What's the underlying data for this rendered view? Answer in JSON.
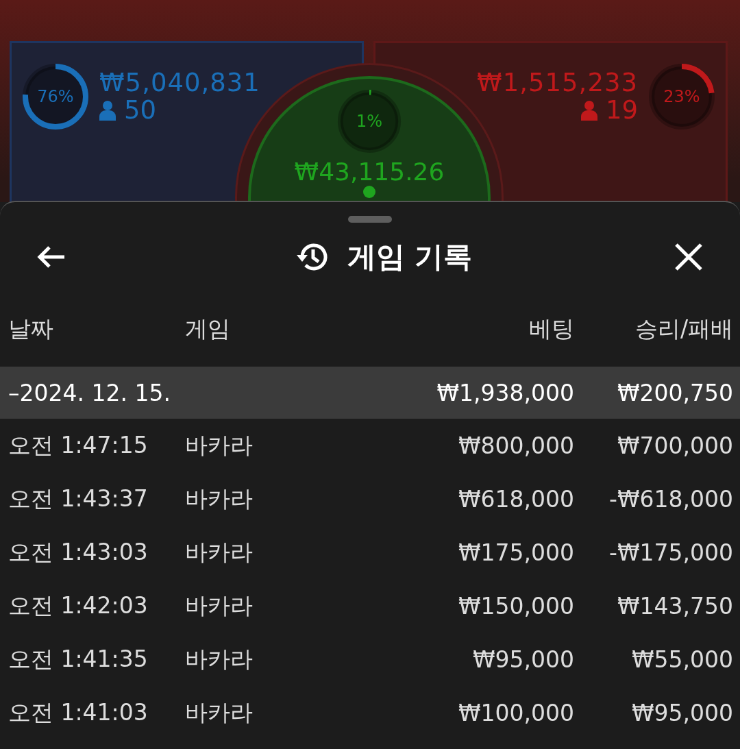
{
  "pools": [
    {
      "kind": "left",
      "level": 0.76,
      "percent": "76%",
      "amount": "₩5,040,831",
      "players": "50",
      "color": "#1a6fb8"
    },
    {
      "kind": "center",
      "level": 0.01,
      "percent": "1%",
      "amount": "₩43,115.26",
      "color": "#1fa51f"
    },
    {
      "kind": "right",
      "level": 0.23,
      "percent": "23%",
      "amount": "₩1,515,233",
      "players": "19",
      "color": "#c0191b"
    }
  ],
  "sheet": {
    "title": "게임 기록"
  },
  "table": {
    "columns": [
      "날짜",
      "게임",
      "베팅",
      "승리/패배"
    ],
    "groups": [
      {
        "date": "–2024. 12. 15.",
        "bet": "₩1,938,000",
        "result": "₩200,750",
        "rows": [
          {
            "time": "오전 1:47:15",
            "game": "바카라",
            "bet": "₩800,000",
            "result": "₩700,000"
          },
          {
            "time": "오전 1:43:37",
            "game": "바카라",
            "bet": "₩618,000",
            "result": "-₩618,000"
          },
          {
            "time": "오전 1:43:03",
            "game": "바카라",
            "bet": "₩175,000",
            "result": "-₩175,000"
          },
          {
            "time": "오전 1:42:03",
            "game": "바카라",
            "bet": "₩150,000",
            "result": "₩143,750"
          },
          {
            "time": "오전 1:41:35",
            "game": "바카라",
            "bet": "₩95,000",
            "result": "₩55,000"
          },
          {
            "time": "오전 1:41:03",
            "game": "바카라",
            "bet": "₩100,000",
            "result": "₩95,000"
          }
        ]
      }
    ]
  }
}
